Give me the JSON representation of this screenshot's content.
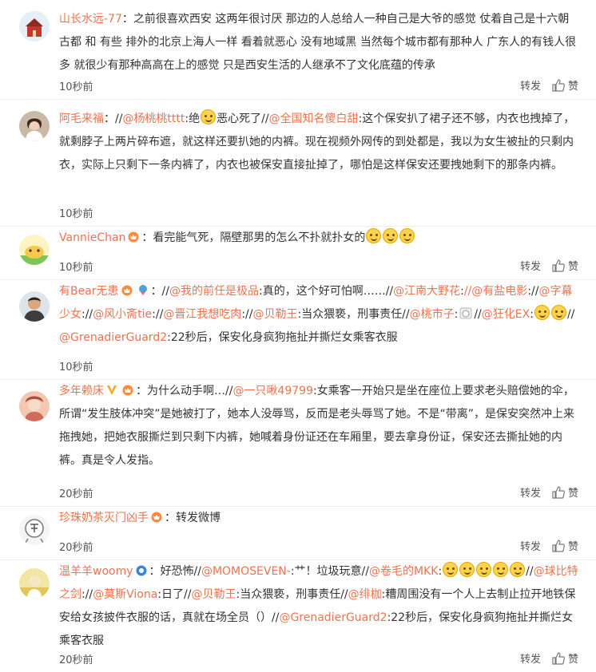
{
  "comments": [
    {
      "user": "山长水远-77",
      "body": "：之前很喜欢西安 这两年很讨厌 那边的人总给人一种自己是大爷的感觉 仗着自己是十六朝古都 和 有些 排外的北京上海人一样 看着就恶心 没有地域黑 当然每个城市都有那种人 广东人的有钱人很多 就很少有那种高高在上的感觉 只是西安生活的人继承不了文化底蕴的传承",
      "time": "10秒前",
      "repost": "转发",
      "like": "赞"
    },
    {
      "user": "阿毛来福",
      "part1": "：//",
      "m1": "@杨桃桃tttt",
      "part2": ":绝",
      "part3": "恶心死了//",
      "m2": "@全国知名傻白甜",
      "part4": ":这个保安扒了裙子还不够，内衣也拽掉了，就剩脖子上两片碎布遮，就这样还要扒她的内裤。现在视频外网传的到处都是，我以为女生被扯的只剩内衣，实际上只剩下一条内裤了，内衣也被保安直接扯掉了，哪怕是这样保安还要拽她剩下的那条内裤。",
      "time": "10秒前"
    },
    {
      "user": "VannieChan",
      "body": "：看完能气死，隔壁那男的怎么不扑就扑女的",
      "time": "10秒前",
      "repost": "转发",
      "like": "赞"
    },
    {
      "user": "有Bear无患",
      "p1": "：//",
      "m1": "@我的前任是极品",
      "p2": ":真的，这个好可怕啊……//",
      "m2": "@江南大野花",
      "p3": ":",
      "m3": "//@有盐电影",
      "p4": "://",
      "m4": "@字幕少女",
      "p5": "://",
      "m5": "@风小斋tie",
      "p6": "://",
      "m6": "@晋江我想吃肉",
      "p7": "://",
      "m7": "@贝勒王",
      "p8": ":当众猥亵，刑事责任//",
      "m8": "@桃市子",
      "p9": ":",
      "p10": "//",
      "m9": "@狂化EX",
      "p11": ":",
      "p12": "//",
      "m10": "@GrenadierGuard2",
      "p13": ":22秒后，保安化身疯狗拖扯并撕烂女乘客衣服",
      "time": "10秒前"
    },
    {
      "user": "多年赖床",
      "p1": "：为什么动手啊…//",
      "m1": "@一只啾49799",
      "p2": ":女乘客一开始只是坐在座位上要求老头赔偿她的伞，所谓“发生肢体冲突”是她被打了，她本人没辱骂，反而是老头辱骂了她。不是“带离”，是保安突然冲上来拖拽她，把她衣服撕烂到只剩下内裤，她喊着身份证还在车厢里，要去拿身份证，保安还去撕扯她的内裤。真是令人发指。",
      "time": "20秒前",
      "repost": "转发",
      "like": "赞"
    },
    {
      "user": "珍珠奶茶灭门凶手",
      "body": "：转发微博",
      "time": "20秒前",
      "repost": "转发",
      "like": "赞"
    },
    {
      "user": "温羊羊woomy",
      "p1": "：好恐怖//",
      "m1": "@MOMOSEVEN-",
      "p2": ":艹！垃圾玩意//",
      "m2": "@卷毛的MKK",
      "p3": ":",
      "p4": "//",
      "m3": "@球比特之剑",
      "p5": "://",
      "m4": "@莫斯Viona",
      "p6": ":日了//",
      "m5": "@贝勒王",
      "p7": ":当众猥亵，刑事责任//",
      "m6": "@绯枷",
      "p8": ":糟周围没有一个人上去制止拉开地铁保安给女孩披件衣服的话，真就在场全员（）//",
      "m7": "@GrenadierGuard2",
      "p9": ":22秒后，保安化身疯狗拖扯并撕烂女乘客衣服",
      "time": "20秒前",
      "repost": "转发",
      "like": "赞"
    }
  ],
  "colors": {
    "username": "#eb7350",
    "text": "#333333",
    "meta": "#555555",
    "divider": "#eeeeee"
  }
}
